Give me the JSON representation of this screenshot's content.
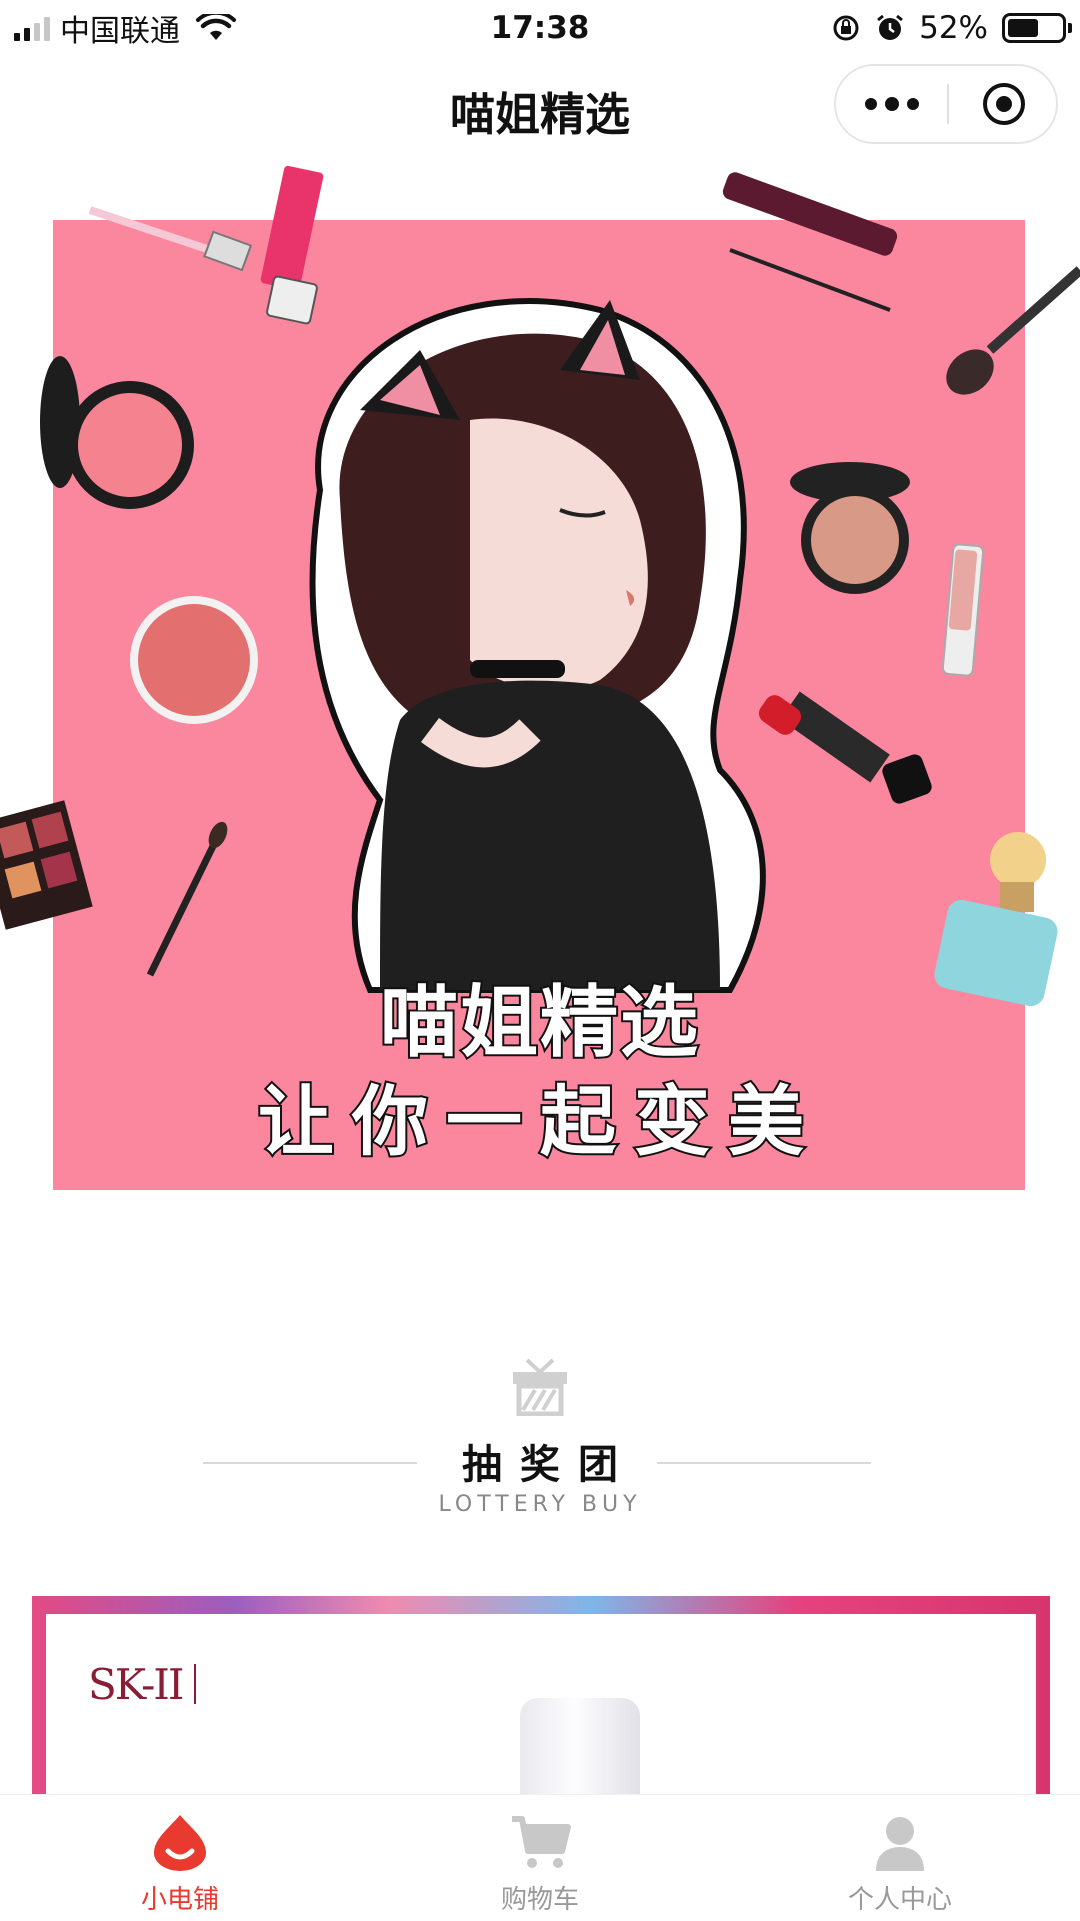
{
  "status_bar": {
    "carrier": "中国联通",
    "time": "17:38",
    "battery": "52%"
  },
  "nav": {
    "title": "喵姐精选"
  },
  "banner": {
    "line1": "喵姐精选",
    "line2": "让你一起变美"
  },
  "section": {
    "title": "抽奖团",
    "subtitle": "LOTTERY BUY"
  },
  "lottery_card": {
    "brand": "SK-II"
  },
  "tabbar": {
    "items": [
      {
        "label": "小电铺",
        "icon": "shop-drop-icon",
        "active": true
      },
      {
        "label": "购物车",
        "icon": "cart-icon",
        "active": false
      },
      {
        "label": "个人中心",
        "icon": "user-icon",
        "active": false
      }
    ]
  },
  "colors": {
    "banner_bg": "#fb879f",
    "active_tab": "#e83a2e",
    "inactive_tab": "#999999"
  }
}
